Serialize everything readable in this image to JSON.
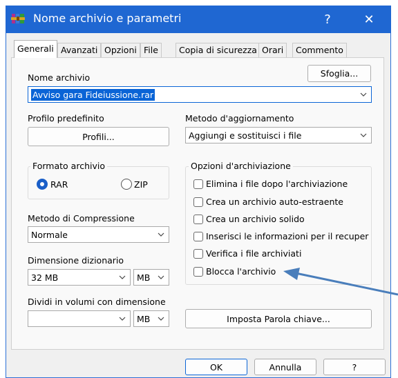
{
  "window": {
    "title": "Nome archivio e parametri",
    "help_glyph": "?",
    "close_glyph": "✕",
    "icon": "winrar-books-icon"
  },
  "tabs": [
    "Generali",
    "Avanzati",
    "Opzioni",
    "File",
    "Copia di sicurezza",
    "Orari",
    "Commento"
  ],
  "archive": {
    "label": "Nome archivio",
    "browse_label": "Sfoglia...",
    "value": "Avviso gara Fideiussione.rar"
  },
  "profile": {
    "label": "Profilo predefinito",
    "button_label": "Profili..."
  },
  "update": {
    "label": "Metodo d'aggiornamento",
    "value": "Aggiungi e sostituisci i file"
  },
  "format": {
    "label": "Formato archivio",
    "rar_label": "RAR",
    "zip_label": "ZIP",
    "selected": "RAR"
  },
  "compression": {
    "label": "Metodo di Compressione",
    "value": "Normale"
  },
  "dictionary": {
    "label": "Dimensione dizionario",
    "value": "32 MB",
    "unit": "MB"
  },
  "volumes": {
    "label": "Dividi in volumi con dimensione",
    "value": "",
    "unit": "MB"
  },
  "options": {
    "label": "Opzioni d'archiviazione",
    "items": [
      {
        "label": "Elimina i file dopo l'archiviazione",
        "checked": false
      },
      {
        "label": "Crea un archivio auto-estraente",
        "checked": false
      },
      {
        "label": "Crea un archivio solido",
        "checked": false
      },
      {
        "label": "Inserisci le informazioni per il recuper",
        "checked": false
      },
      {
        "label": "Verifica i file archiviati",
        "checked": false
      },
      {
        "label": "Blocca l'archivio",
        "checked": false
      }
    ]
  },
  "password_button": "Imposta Parola chiave...",
  "footer": {
    "ok": "OK",
    "cancel": "Annulla",
    "help": "?"
  },
  "colors": {
    "titlebar": "#1f67d2",
    "selection": "#0a64d6",
    "arrow_annotation": "#4a7ebb",
    "radio_selected": "#1a5fc8"
  }
}
